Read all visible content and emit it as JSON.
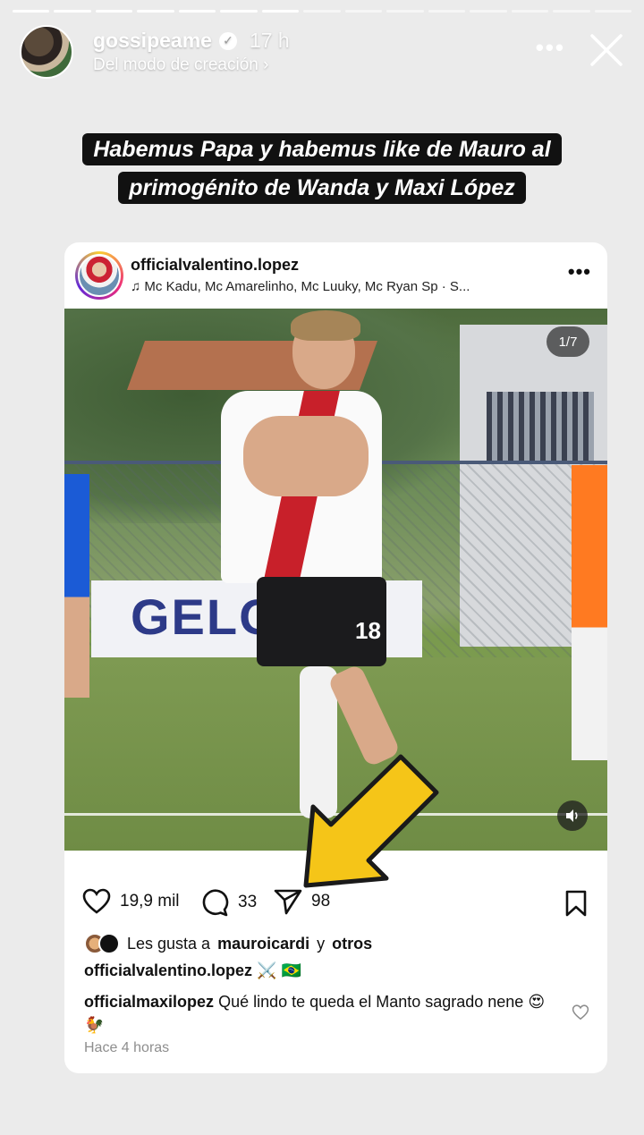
{
  "story": {
    "progress_total": 15,
    "progress_done": 7,
    "username": "gossipeame",
    "verified_mark": "✓",
    "time": "17 h",
    "subtitle": "Del modo de creación ›",
    "more_icon": "more-horizontal-icon",
    "close_icon": "close-icon"
  },
  "headline": {
    "line1": "Habemus Papa y habemus like de Mauro al",
    "line2": "primogénito de Wanda y Maxi López"
  },
  "post": {
    "username": "officialvalentino.lopez",
    "music_icon": "♫",
    "music": "Mc Kadu, Mc Amarelinho, Mc Luuky, Mc Ryan Sp · S...",
    "more": "•••",
    "counter": "1/7",
    "banner_text": "GELO",
    "jersey_number": "18",
    "likes_count": "19,9 mil",
    "comments_count": "33",
    "shares_count": "98",
    "liked_by_prefix": "Les gusta a",
    "liked_by_user": "mauroicardi",
    "liked_by_middle": "y",
    "liked_by_others": "otros",
    "caption_user": "officialvalentino.lopez",
    "caption_emoji": "⚔️ 🇧🇷",
    "comment_user": "officialmaxilopez",
    "comment_text": "Qué lindo te queda el Manto sagrado nene 😍 🐓",
    "timestamp": "Hace 4 horas"
  },
  "colors": {
    "background": "#ebebeb",
    "headline_bg": "#111111",
    "arrow": "#f5c518",
    "river_red": "#c8202a"
  }
}
